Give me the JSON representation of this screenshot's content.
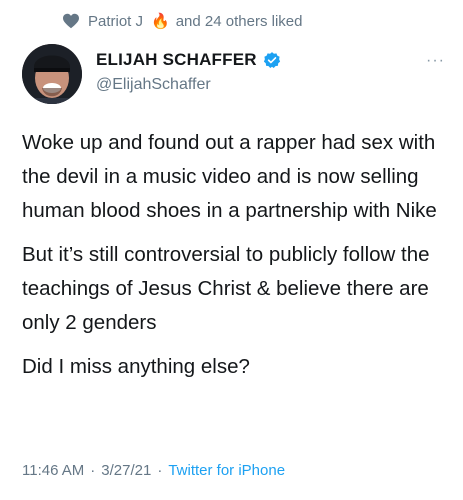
{
  "social_context": {
    "liker_name": "Patriot J",
    "liker_emoji": "🔥",
    "others_text": "and 24 others liked"
  },
  "author": {
    "display_name": "ELIJAH SCHAFFER",
    "handle": "@ElijahSchaffer",
    "verified": true
  },
  "tweet": {
    "paragraphs": [
      "Woke up and found out a rapper had sex with the devil in a music video and is now selling human blood shoes in a partnership with Nike",
      "But it’s still controversial to publicly follow the teachings of Jesus Christ & believe there are only 2 genders",
      "Did I miss anything else?"
    ]
  },
  "meta": {
    "time": "11:46 AM",
    "separator": "·",
    "date": "3/27/21",
    "source": "Twitter for iPhone"
  },
  "colors": {
    "accent": "#1da1f2",
    "secondary_text": "#657786",
    "primary_text": "#14171a"
  }
}
